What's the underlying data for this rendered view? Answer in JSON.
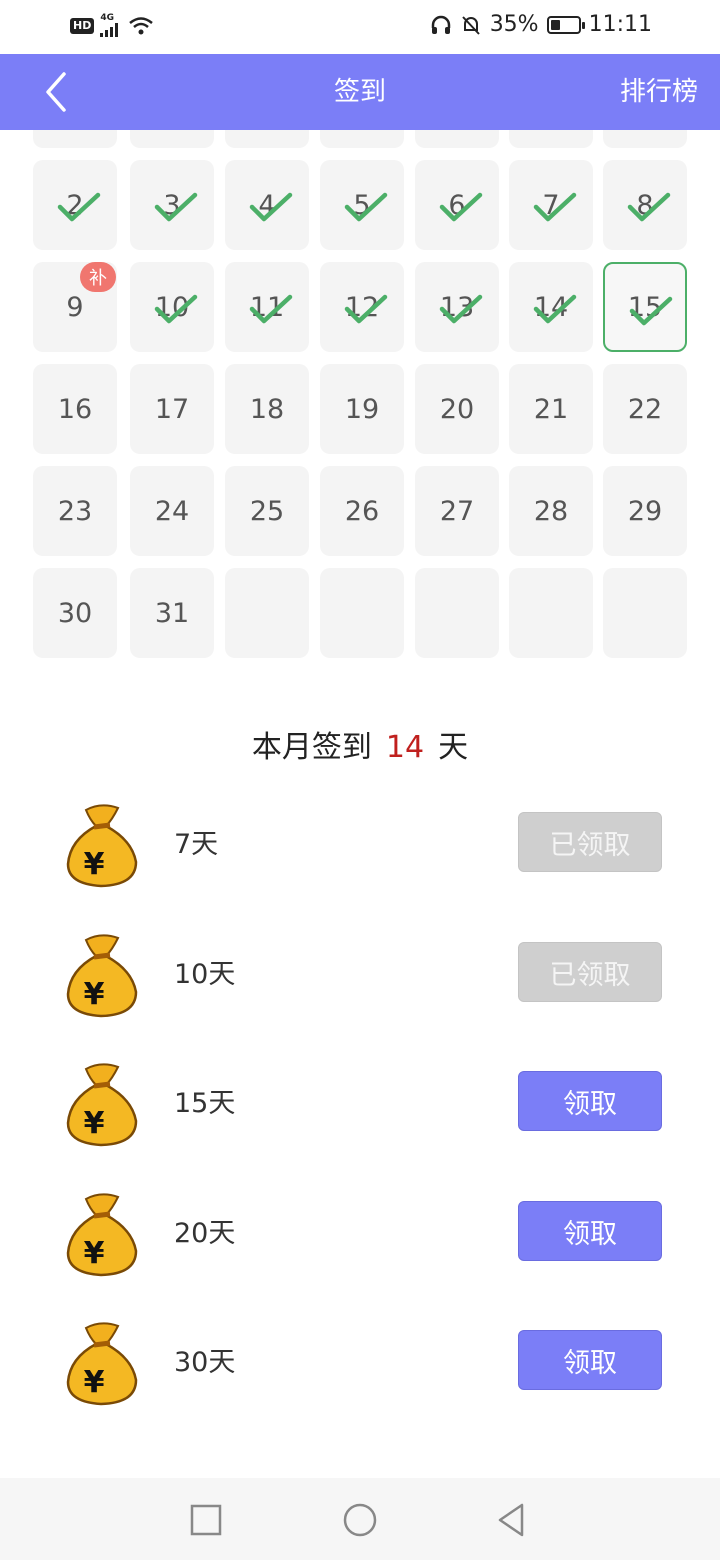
{
  "status_bar": {
    "network_badge": "HD",
    "network_gen": "4G",
    "battery": "35%",
    "battery_level": 0.35,
    "time": "11:11"
  },
  "header": {
    "title": "签到",
    "ranking_label": "排行榜"
  },
  "calendar": {
    "rows": [
      [
        {
          "day": "2",
          "checked": true
        },
        {
          "day": "3",
          "checked": true
        },
        {
          "day": "4",
          "checked": true
        },
        {
          "day": "5",
          "checked": true
        },
        {
          "day": "6",
          "checked": true
        },
        {
          "day": "7",
          "checked": true
        },
        {
          "day": "8",
          "checked": true
        }
      ],
      [
        {
          "day": "9",
          "checked": false,
          "makeup": "补"
        },
        {
          "day": "10",
          "checked": true
        },
        {
          "day": "11",
          "checked": true
        },
        {
          "day": "12",
          "checked": true
        },
        {
          "day": "13",
          "checked": true
        },
        {
          "day": "14",
          "checked": true
        },
        {
          "day": "15",
          "checked": true,
          "today": true
        }
      ],
      [
        {
          "day": "16"
        },
        {
          "day": "17"
        },
        {
          "day": "18"
        },
        {
          "day": "19"
        },
        {
          "day": "20"
        },
        {
          "day": "21"
        },
        {
          "day": "22"
        }
      ],
      [
        {
          "day": "23"
        },
        {
          "day": "24"
        },
        {
          "day": "25"
        },
        {
          "day": "26"
        },
        {
          "day": "27"
        },
        {
          "day": "28"
        },
        {
          "day": "29"
        }
      ],
      [
        {
          "day": "30"
        },
        {
          "day": "31"
        },
        {
          "day": ""
        },
        {
          "day": ""
        },
        {
          "day": ""
        },
        {
          "day": ""
        },
        {
          "day": ""
        }
      ]
    ]
  },
  "summary": {
    "prefix": "本月签到",
    "count": "14",
    "suffix": "天"
  },
  "rewards": [
    {
      "label": "7天",
      "button": "已领取",
      "claimed": true
    },
    {
      "label": "10天",
      "button": "已领取",
      "claimed": true
    },
    {
      "label": "15天",
      "button": "领取",
      "claimed": false
    },
    {
      "label": "20天",
      "button": "领取",
      "claimed": false
    },
    {
      "label": "30天",
      "button": "领取",
      "claimed": false
    }
  ],
  "colors": {
    "accent": "#7b7ef7",
    "check_green": "#4caf68",
    "count_red": "#c0201e",
    "makeup_badge": "#f0766f"
  },
  "icons": {
    "back": "chevron-left-icon",
    "check": "checkmark-icon",
    "bag": "money-bag-icon",
    "nav": [
      "square-icon",
      "circle-icon",
      "triangle-back-icon"
    ]
  }
}
